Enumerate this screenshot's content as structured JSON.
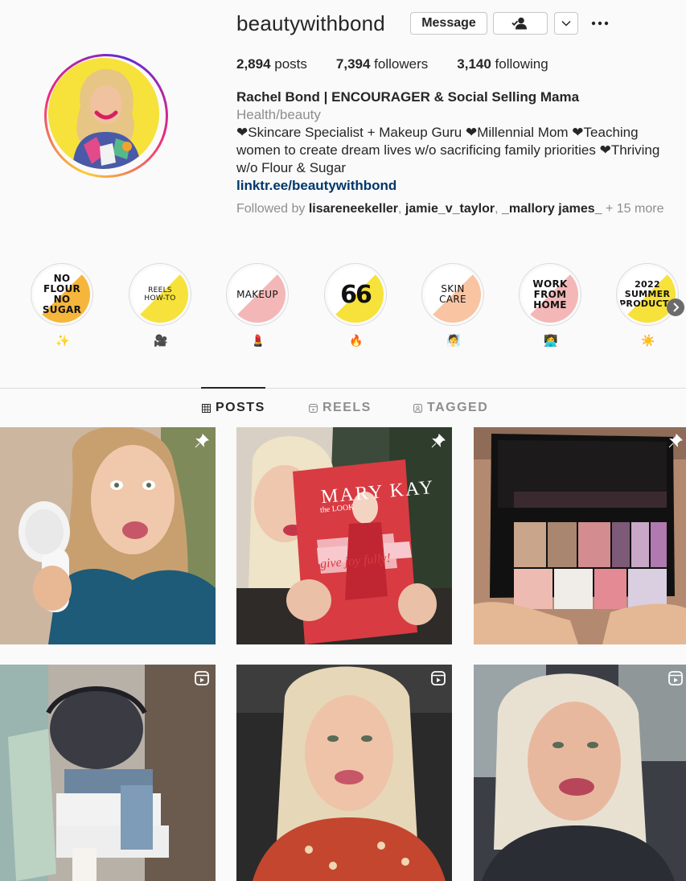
{
  "profile": {
    "username": "beautywithbond",
    "buttons": {
      "message": "Message",
      "follow_icon": "person-check-icon",
      "more_icon": "chevron-down-icon",
      "options_icon": "ellipsis-icon"
    },
    "stats": {
      "posts_count": "2,894",
      "posts_label": " posts",
      "followers_count": "7,394",
      "followers_label": " followers",
      "following_count": "3,140",
      "following_label": " following"
    },
    "full_name": "Rachel Bond | ENCOURAGER & Social Selling Mama",
    "category": "Health/beauty",
    "bio_lines": [
      "❤Skincare Specialist + Makeup Guru ❤Millennial Mom ❤Teaching women to create dream lives w/o sacrificing family priorities ❤Thriving w/o Flour & Sugar"
    ],
    "link": "linktr.ee/beautywithbond",
    "followed_by": {
      "prefix": "Followed by ",
      "users": [
        "lisareneekeller",
        "jamie_v_taylor",
        "_mallory james_"
      ],
      "suffix": " + 15 more"
    }
  },
  "highlights": [
    {
      "title": "NO\nFLOUR\nNO\nSUGAR",
      "label": "✨"
    },
    {
      "title": "REELS\nHOW-TO",
      "label": "🎥"
    },
    {
      "title": "MAKEUP",
      "label": "💄"
    },
    {
      "title": "66",
      "label": "🔥"
    },
    {
      "title": "SKIN\nCARE",
      "label": "🧖"
    },
    {
      "title": "WORK\nFROM\nHOME",
      "label": "👩‍💻"
    },
    {
      "title": "2022\nSUMMER\nPRODUCTS",
      "label": "☀️"
    }
  ],
  "tabs": [
    {
      "label": "POSTS",
      "icon": "grid-icon",
      "active": true
    },
    {
      "label": "REELS",
      "icon": "reels-icon",
      "active": false
    },
    {
      "label": "TAGGED",
      "icon": "tag-icon",
      "active": false
    }
  ],
  "posts": [
    {
      "badge": "pin-icon",
      "subject": "cleansing-brush-selfie"
    },
    {
      "badge": "pin-icon",
      "subject": "mary-kay-look-book",
      "book_brand": "MARY KAY",
      "book_title": "the LOOK",
      "book_tagline": "give joy fully!"
    },
    {
      "badge": "pin-icon",
      "subject": "eyeshadow-palette"
    },
    {
      "badge": "reel-icon",
      "subject": "diaper-cake"
    },
    {
      "badge": "reel-icon",
      "subject": "car-selfie-red-blouse"
    },
    {
      "badge": "reel-icon",
      "subject": "car-selfie-lipstick"
    }
  ],
  "colors": {
    "link": "#00376b",
    "secondary_text": "#8e8e8e",
    "highlight_yellow": "#f6e23a",
    "highlight_orange": "#f5b63b",
    "highlight_pink": "#f3b7b7"
  }
}
